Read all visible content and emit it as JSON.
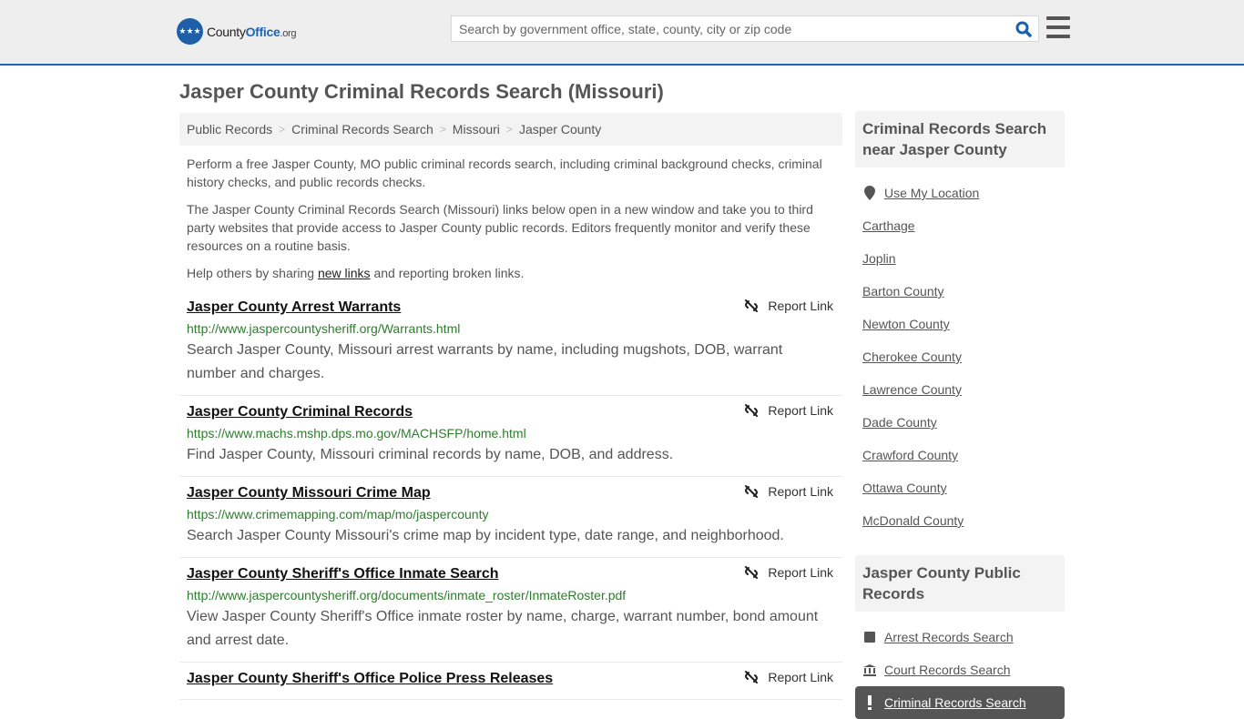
{
  "header": {
    "logo": {
      "name": "County",
      "name_bold": "Office",
      "tld": ".org"
    },
    "search": {
      "placeholder": "Search by government office, state, county, city or zip code",
      "value": ""
    }
  },
  "page_title": "Jasper County Criminal Records Search (Missouri)",
  "breadcrumb": [
    "Public Records",
    "Criminal Records Search",
    "Missouri",
    "Jasper County"
  ],
  "intro": {
    "p1": "Perform a free Jasper County, MO public criminal records search, including criminal background checks, criminal history checks, and public records checks.",
    "p2": "The Jasper County Criminal Records Search (Missouri) links below open in a new window and take you to third party websites that provide access to Jasper County public records. Editors frequently monitor and verify these resources on a routine basis.",
    "p3_before": "Help others by sharing ",
    "p3_link": "new links",
    "p3_after": " and reporting broken links."
  },
  "report_label": "Report Link",
  "records": [
    {
      "title": "Jasper County Arrest Warrants",
      "url": "http://www.jaspercountysheriff.org/Warrants.html",
      "desc": "Search Jasper County, Missouri arrest warrants by name, including mugshots, DOB, warrant number and charges."
    },
    {
      "title": "Jasper County Criminal Records",
      "url": "https://www.machs.mshp.dps.mo.gov/MACHSFP/home.html",
      "desc": "Find Jasper County, Missouri criminal records by name, DOB, and address."
    },
    {
      "title": "Jasper County Missouri Crime Map",
      "url": "https://www.crimemapping.com/map/mo/jaspercounty",
      "desc": "Search Jasper County Missouri's crime map by incident type, date range, and neighborhood."
    },
    {
      "title": "Jasper County Sheriff's Office Inmate Search",
      "url": "http://www.jaspercountysheriff.org/documents/inmate_roster/InmateRoster.pdf",
      "desc": "View Jasper County Sheriff's Office inmate roster by name, charge, warrant number, bond amount and arrest date."
    },
    {
      "title": "Jasper County Sheriff's Office Police Press Releases",
      "url": "",
      "desc": ""
    }
  ],
  "sidebar": {
    "nearby": {
      "heading": "Criminal Records Search near Jasper County",
      "use_location": "Use My Location",
      "items": [
        "Carthage",
        "Joplin",
        "Barton County",
        "Newton County",
        "Cherokee County",
        "Lawrence County",
        "Dade County",
        "Crawford County",
        "Ottawa County",
        "McDonald County"
      ]
    },
    "public_records": {
      "heading": "Jasper County Public Records",
      "items": [
        {
          "label": "Arrest Records Search",
          "icon": "square-icon"
        },
        {
          "label": "Court Records Search",
          "icon": "courthouse-icon"
        },
        {
          "label": "Criminal Records Search",
          "icon": "exclamation-icon",
          "active": true
        }
      ]
    }
  }
}
